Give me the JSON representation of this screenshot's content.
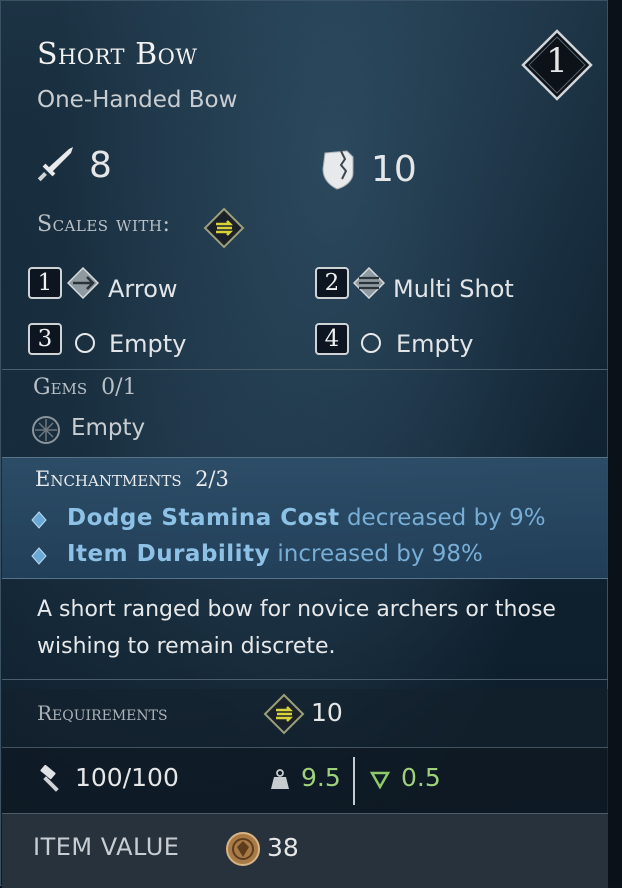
{
  "item": {
    "name": "Short Bow",
    "type": "One-Handed Bow",
    "tier": "1"
  },
  "stats": {
    "damage": "8",
    "block": "10",
    "scales_with_label": "Scales with:"
  },
  "slots": [
    {
      "number": "1",
      "label": "Arrow",
      "icon": "arrow-rune-icon"
    },
    {
      "number": "2",
      "label": "Multi Shot",
      "icon": "multi-shot-rune-icon"
    },
    {
      "number": "3",
      "label": "Empty",
      "icon": "empty-circle-icon"
    },
    {
      "number": "4",
      "label": "Empty",
      "icon": "empty-circle-icon"
    }
  ],
  "gems": {
    "label": "Gems",
    "count": "0/1",
    "slot_label": "Empty"
  },
  "enchantments": {
    "label": "Enchantments",
    "count": "2/3",
    "items": [
      {
        "name": "Dodge Stamina Cost",
        "effect": "decreased by 9%"
      },
      {
        "name": "Item Durability",
        "effect": "increased by 98%"
      }
    ]
  },
  "description": "A short ranged bow for novice archers or those wishing to remain discrete.",
  "requirements": {
    "label": "Requirements",
    "value": "10"
  },
  "durability": "100/100",
  "weight": "9.5",
  "gain": "0.5",
  "item_value": {
    "label": "ITEM VALUE",
    "value": "38"
  },
  "colors": {
    "enchant_name": "#8ec1e6",
    "enchant_desc": "#78aed6",
    "weight_green": "#9fd07a",
    "attribute_accent": "#d8d23a"
  }
}
